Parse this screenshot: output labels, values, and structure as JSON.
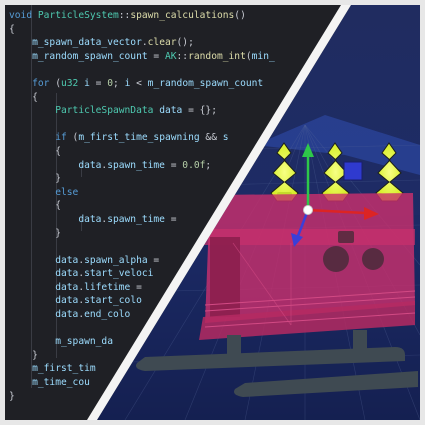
{
  "code_editor": {
    "lines": [
      [
        [
          "kw",
          "void"
        ],
        [
          "pl",
          " "
        ],
        [
          "ty",
          "ParticleSystem"
        ],
        [
          "pl",
          "::"
        ],
        [
          "fn",
          "spawn_calculations"
        ],
        [
          "pl",
          "()"
        ]
      ],
      [
        [
          "pl",
          "{"
        ]
      ],
      [
        [
          "pl",
          "    "
        ],
        [
          "var",
          "m_spawn_data_vector"
        ],
        [
          "pl",
          "."
        ],
        [
          "fn",
          "clear"
        ],
        [
          "pl",
          "();"
        ]
      ],
      [
        [
          "pl",
          "    "
        ],
        [
          "var",
          "m_random_spawn_count"
        ],
        [
          "pl",
          " = "
        ],
        [
          "ty",
          "AK"
        ],
        [
          "pl",
          "::"
        ],
        [
          "fn",
          "random_int"
        ],
        [
          "pl",
          "("
        ],
        [
          "var",
          "min_"
        ]
      ],
      [
        [
          "pl",
          ""
        ]
      ],
      [
        [
          "pl",
          "    "
        ],
        [
          "kw",
          "for"
        ],
        [
          "pl",
          " ("
        ],
        [
          "ty",
          "u32"
        ],
        [
          "pl",
          " "
        ],
        [
          "var",
          "i"
        ],
        [
          "pl",
          " = "
        ],
        [
          "num",
          "0"
        ],
        [
          "pl",
          "; "
        ],
        [
          "var",
          "i"
        ],
        [
          "pl",
          " < "
        ],
        [
          "var",
          "m_random_spawn_count"
        ]
      ],
      [
        [
          "pl",
          "    {"
        ]
      ],
      [
        [
          "pl",
          "        "
        ],
        [
          "ty",
          "ParticleSpawnData"
        ],
        [
          "pl",
          " "
        ],
        [
          "var",
          "data"
        ],
        [
          "pl",
          " = {};"
        ]
      ],
      [
        [
          "pl",
          ""
        ]
      ],
      [
        [
          "pl",
          "        "
        ],
        [
          "kw",
          "if"
        ],
        [
          "pl",
          " ("
        ],
        [
          "var",
          "m_first_time_spawning"
        ],
        [
          "pl",
          " && "
        ],
        [
          "var",
          "s"
        ]
      ],
      [
        [
          "pl",
          "        {"
        ]
      ],
      [
        [
          "pl",
          "            "
        ],
        [
          "var",
          "data"
        ],
        [
          "pl",
          "."
        ],
        [
          "var",
          "spawn_time"
        ],
        [
          "pl",
          " = "
        ],
        [
          "num",
          "0.0f"
        ],
        [
          "pl",
          ";"
        ]
      ],
      [
        [
          "pl",
          "        }"
        ]
      ],
      [
        [
          "pl",
          "        "
        ],
        [
          "kw",
          "else"
        ]
      ],
      [
        [
          "pl",
          "        {"
        ]
      ],
      [
        [
          "pl",
          "            "
        ],
        [
          "var",
          "data"
        ],
        [
          "pl",
          "."
        ],
        [
          "var",
          "spawn_time"
        ],
        [
          "pl",
          " ="
        ]
      ],
      [
        [
          "pl",
          "        }"
        ]
      ],
      [
        [
          "pl",
          ""
        ]
      ],
      [
        [
          "pl",
          "        "
        ],
        [
          "var",
          "data"
        ],
        [
          "pl",
          "."
        ],
        [
          "var",
          "spawn_alpha"
        ],
        [
          "pl",
          " ="
        ]
      ],
      [
        [
          "pl",
          "        "
        ],
        [
          "var",
          "data"
        ],
        [
          "pl",
          "."
        ],
        [
          "var",
          "start_veloci"
        ]
      ],
      [
        [
          "pl",
          "        "
        ],
        [
          "var",
          "data"
        ],
        [
          "pl",
          "."
        ],
        [
          "var",
          "lifetime"
        ],
        [
          "pl",
          " ="
        ]
      ],
      [
        [
          "pl",
          "        "
        ],
        [
          "var",
          "data"
        ],
        [
          "pl",
          "."
        ],
        [
          "var",
          "start_colo"
        ]
      ],
      [
        [
          "pl",
          "        "
        ],
        [
          "var",
          "data"
        ],
        [
          "pl",
          "."
        ],
        [
          "var",
          "end_colo"
        ]
      ],
      [
        [
          "pl",
          ""
        ]
      ],
      [
        [
          "pl",
          "        "
        ],
        [
          "var",
          "m_spawn_da"
        ]
      ],
      [
        [
          "pl",
          "    }"
        ]
      ],
      [
        [
          "pl",
          "    "
        ],
        [
          "var",
          "m_first_tim"
        ]
      ],
      [
        [
          "pl",
          "    "
        ],
        [
          "var",
          "m_time_cou"
        ]
      ],
      [
        [
          "pl",
          "}"
        ]
      ]
    ]
  },
  "viewport": {
    "colors": {
      "background": "#11183a",
      "grid": "#5a6a9c",
      "vehicle": "#c0306a",
      "runners": "#3f4a52",
      "tree": "#d8ef2a",
      "axis_x": "#dc2424",
      "axis_y": "#2ec84a",
      "axis_z": "#3a3fd8"
    }
  }
}
